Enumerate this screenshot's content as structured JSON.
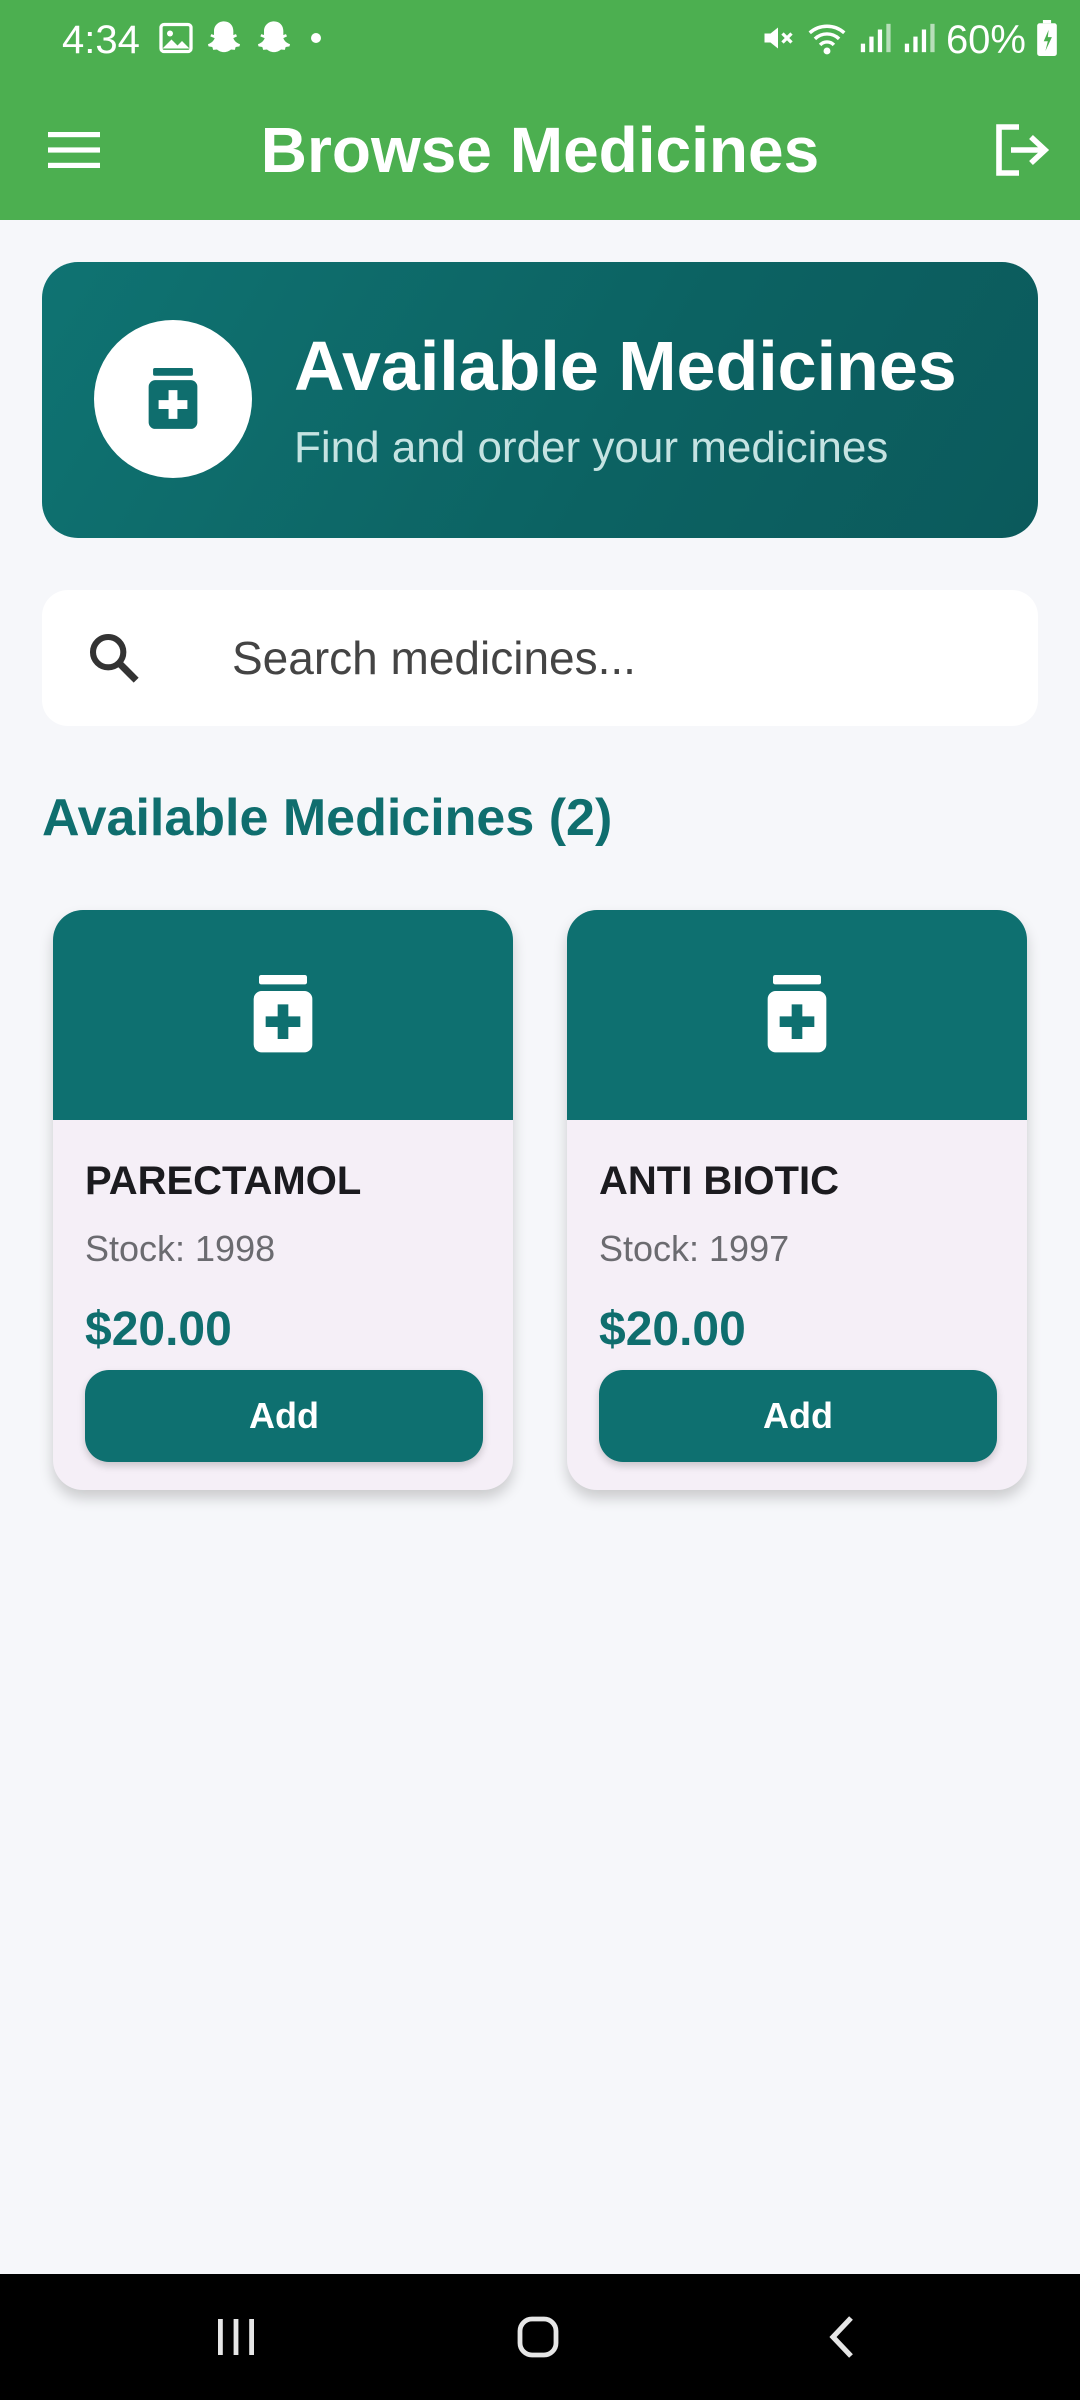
{
  "status_bar": {
    "time": "4:34",
    "battery": "60%",
    "left_icons": [
      "gallery-icon",
      "snapchat-icon",
      "snapchat-icon",
      "dot-icon"
    ],
    "right_icons": [
      "mute-icon",
      "wifi-icon",
      "signal-icon",
      "signal-icon",
      "battery-icon"
    ]
  },
  "app_bar": {
    "title": "Browse Medicines",
    "left_icon": "menu-icon",
    "right_icon": "logout-icon",
    "color": "#4caf50"
  },
  "hero": {
    "title": "Available Medicines",
    "subtitle": "Find and order your medicines",
    "icon": "medicine-bottle-icon",
    "color": "#0f7372"
  },
  "search": {
    "placeholder": "Search medicines...",
    "value": "",
    "icon": "search-icon"
  },
  "list": {
    "heading": "Available Medicines (2)",
    "items": [
      {
        "name": "PARECTAMOL",
        "stock": "Stock: 1998",
        "price": "$20.00",
        "button": "Add",
        "icon": "medicine-bottle-icon"
      },
      {
        "name": "ANTI BIOTIC",
        "stock": "Stock: 1997",
        "price": "$20.00",
        "button": "Add",
        "icon": "medicine-bottle-icon"
      }
    ]
  },
  "nav_bar": {
    "buttons": [
      "recents-icon",
      "home-icon",
      "back-icon"
    ]
  },
  "colors": {
    "accent": "#0e7070",
    "background": "#f6f7fa",
    "card_background": "#f5eff7"
  }
}
